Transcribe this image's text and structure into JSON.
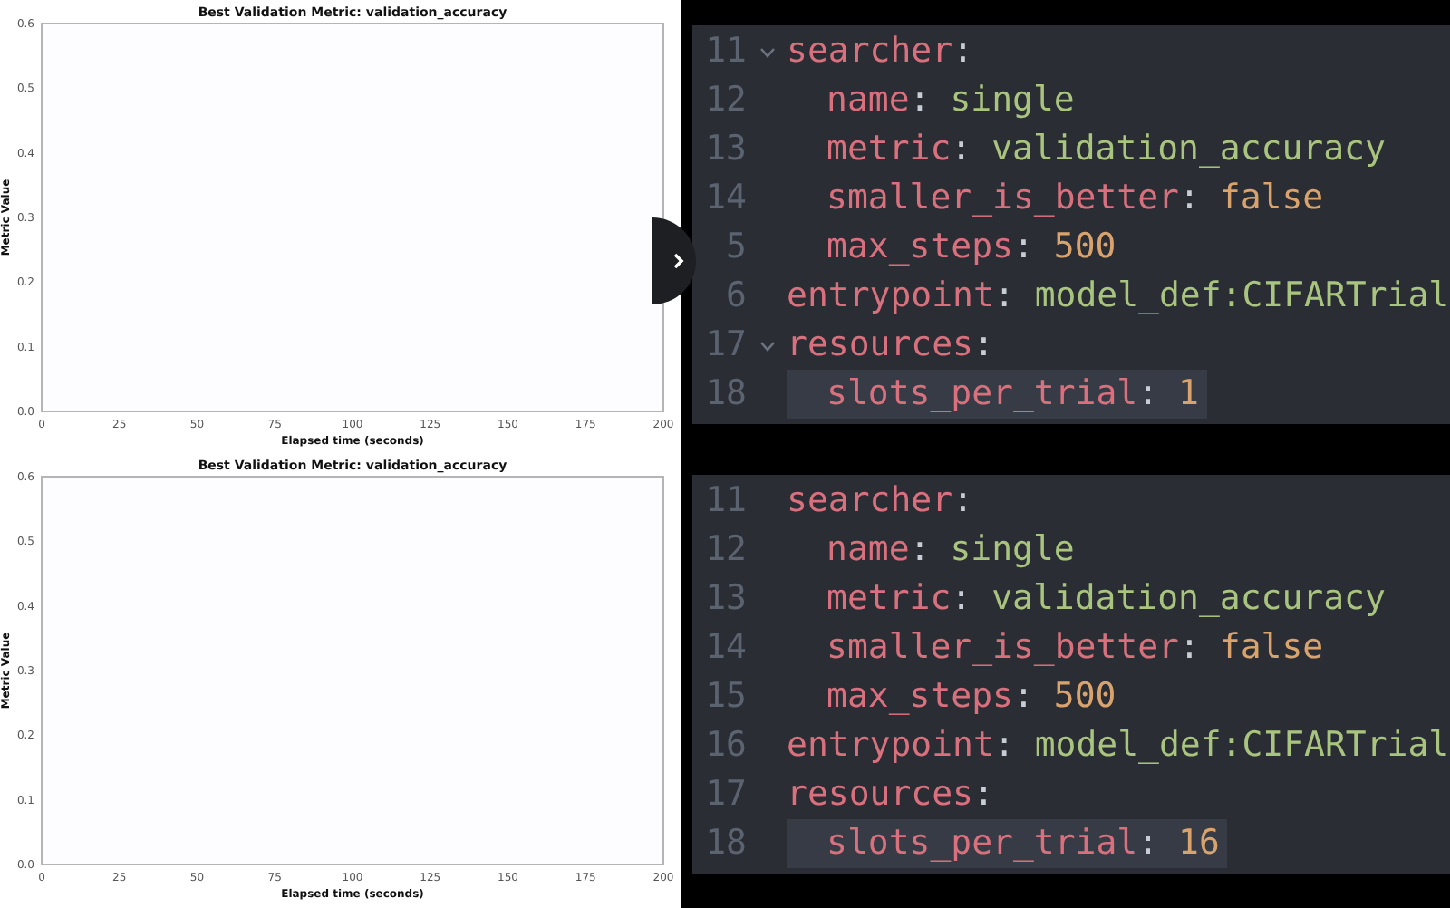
{
  "charts": [
    {
      "chart_data": {
        "type": "line",
        "title": "Best Validation Metric: validation_accuracy",
        "xlabel": "Elapsed time (seconds)",
        "ylabel": "Metric Value",
        "xlim": [
          0,
          200
        ],
        "ylim": [
          0,
          0.6
        ],
        "xticks": [
          0,
          25,
          50,
          75,
          100,
          125,
          150,
          175,
          200
        ],
        "yticks": [
          {
            "value": 0,
            "label": "0.0"
          },
          {
            "value": 0.1,
            "label": "0.1"
          },
          {
            "value": 0.2,
            "label": "0.2"
          },
          {
            "value": 0.3,
            "label": "0.3"
          },
          {
            "value": 0.4,
            "label": "0.4"
          },
          {
            "value": 0.5,
            "label": "0.5"
          },
          {
            "value": 0.6,
            "label": "0.6"
          }
        ]
      }
    },
    {
      "chart_data": {
        "type": "line",
        "title": "Best Validation Metric: validation_accuracy",
        "xlabel": "Elapsed time (seconds)",
        "ylabel": "Metric Value",
        "xlim": [
          0,
          200
        ],
        "ylim": [
          0,
          0.6
        ],
        "xticks": [
          0,
          25,
          50,
          75,
          100,
          125,
          150,
          175,
          200
        ],
        "yticks": [
          {
            "value": 0,
            "label": "0.0"
          },
          {
            "value": 0.1,
            "label": "0.1"
          },
          {
            "value": 0.2,
            "label": "0.2"
          },
          {
            "value": 0.3,
            "label": "0.3"
          },
          {
            "value": 0.4,
            "label": "0.4"
          },
          {
            "value": 0.5,
            "label": "0.5"
          },
          {
            "value": 0.6,
            "label": "0.6"
          }
        ]
      }
    }
  ],
  "editors": [
    {
      "lines": [
        {
          "number": "11",
          "key": "searcher",
          "colon": ":",
          "fold_caret": true,
          "current": false,
          "children": [
            {
              "number": "12",
              "key": "name",
              "colon": ":",
              "value": "single",
              "kind": "string",
              "current": false
            },
            {
              "number": "13",
              "key": "metric",
              "colon": ":",
              "value": "validation_accuracy",
              "kind": "string",
              "current": false
            },
            {
              "number": "14",
              "key": "smaller_is_better",
              "colon": ":",
              "value": "false",
              "kind": "scalar",
              "current": false
            },
            {
              "number": "5",
              "key": "max_steps",
              "colon": ":",
              "value": "500",
              "kind": "scalar",
              "current": false
            }
          ]
        },
        {
          "number": "6",
          "key": "entrypoint",
          "colon": ":",
          "value": "model_def:CIFARTrial",
          "kind": "string",
          "current": false
        },
        {
          "number": "17",
          "key": "resources",
          "colon": ":",
          "fold_caret": true,
          "current": false,
          "children": [
            {
              "number": "18",
              "key": "slots_per_trial",
              "colon": ":",
              "value": "1",
              "kind": "scalar",
              "current": true
            }
          ]
        }
      ]
    },
    {
      "lines": [
        {
          "number": "11",
          "key": "searcher",
          "colon": ":",
          "fold_caret": false,
          "current": false,
          "children": [
            {
              "number": "12",
              "key": "name",
              "colon": ":",
              "value": "single",
              "kind": "string",
              "current": false
            },
            {
              "number": "13",
              "key": "metric",
              "colon": ":",
              "value": "validation_accuracy",
              "kind": "string",
              "current": false
            },
            {
              "number": "14",
              "key": "smaller_is_better",
              "colon": ":",
              "value": "false",
              "kind": "scalar",
              "current": false
            },
            {
              "number": "15",
              "key": "max_steps",
              "colon": ":",
              "value": "500",
              "kind": "scalar",
              "current": false
            }
          ]
        },
        {
          "number": "16",
          "key": "entrypoint",
          "colon": ":",
          "value": "model_def:CIFARTrial",
          "kind": "string",
          "current": false
        },
        {
          "number": "17",
          "key": "resources",
          "colon": ":",
          "fold_caret": false,
          "current": false,
          "children": [
            {
              "number": "18",
              "key": "slots_per_trial",
              "colon": ":",
              "value": "16",
              "kind": "scalar",
              "current": true
            }
          ]
        }
      ]
    }
  ]
}
